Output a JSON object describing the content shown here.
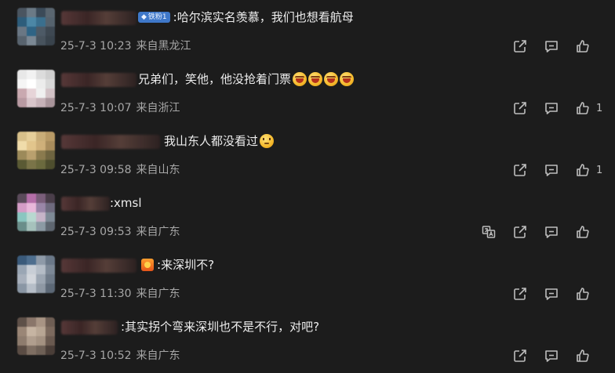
{
  "comments": [
    {
      "badge": "铁粉1",
      "prefix": ":",
      "text": "哈尔滨实名羡慕，我们也想看航母",
      "date": "25-7-3 10:23",
      "location": "来自黑龙江",
      "likes": "",
      "emojis": []
    },
    {
      "badge": "",
      "prefix": "",
      "text": "兄弟们，笑他，他没抢着门票",
      "date": "25-7-3 10:07",
      "location": "来自浙江",
      "likes": "1",
      "emojis": [
        "laugh-emoji",
        "laugh-emoji",
        "laugh-emoji",
        "laugh-emoji"
      ]
    },
    {
      "badge": "",
      "prefix": "",
      "text": "我山东人都没看过",
      "date": "25-7-3 09:58",
      "location": "来自山东",
      "likes": "1",
      "emojis": [
        "thinking-emoji"
      ]
    },
    {
      "badge": "",
      "prefix": "",
      "text": ":xmsl",
      "date": "25-7-3 09:53",
      "location": "来自广东",
      "likes": "",
      "emojis": []
    },
    {
      "badge": "",
      "prefix": ":",
      "text": "来深圳不?",
      "date": "25-7-3 11:30",
      "location": "来自广东",
      "likes": "",
      "emojis": []
    },
    {
      "badge": "",
      "prefix": ":",
      "text": "其实拐个弯来深圳也不是不行，对吧?",
      "date": "25-7-3 10:52",
      "location": "来自广东",
      "likes": "",
      "emojis": []
    }
  ],
  "colors": {
    "background": "#1c1c1c",
    "text": "#ededed",
    "meta": "#a6a6a6",
    "icon": "#bdbdbd",
    "badge": "#3f78c9"
  }
}
